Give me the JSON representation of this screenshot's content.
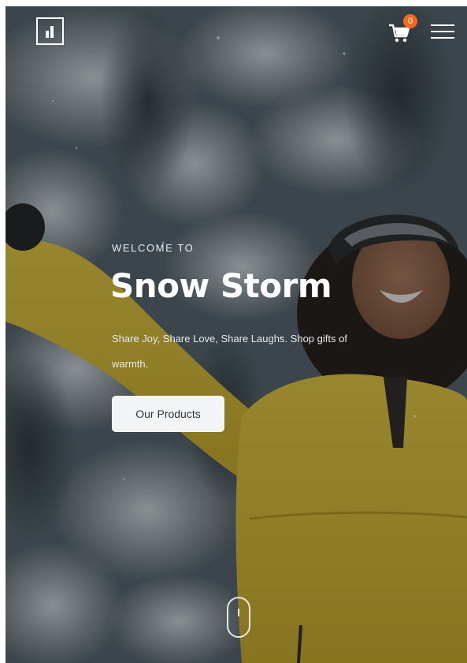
{
  "header": {
    "logo_icon": "bar-chart-logo-icon",
    "cart_icon": "shopping-cart-icon",
    "cart_count": "0",
    "cart_badge_color": "#f26b1d",
    "menu_icon": "hamburger-menu-icon"
  },
  "hero": {
    "kicker": "WELCOME TO",
    "title": "Snow Storm",
    "subtitle": "Share Joy, Share Love, Share Laughs. Shop gifts of warmth.",
    "cta_label": "Our Products"
  },
  "scroll_indicator": {
    "icon": "mouse-scroll-icon"
  },
  "colors": {
    "jacket_yellow": "#e6c633",
    "button_bg": "#f3f4f5"
  }
}
